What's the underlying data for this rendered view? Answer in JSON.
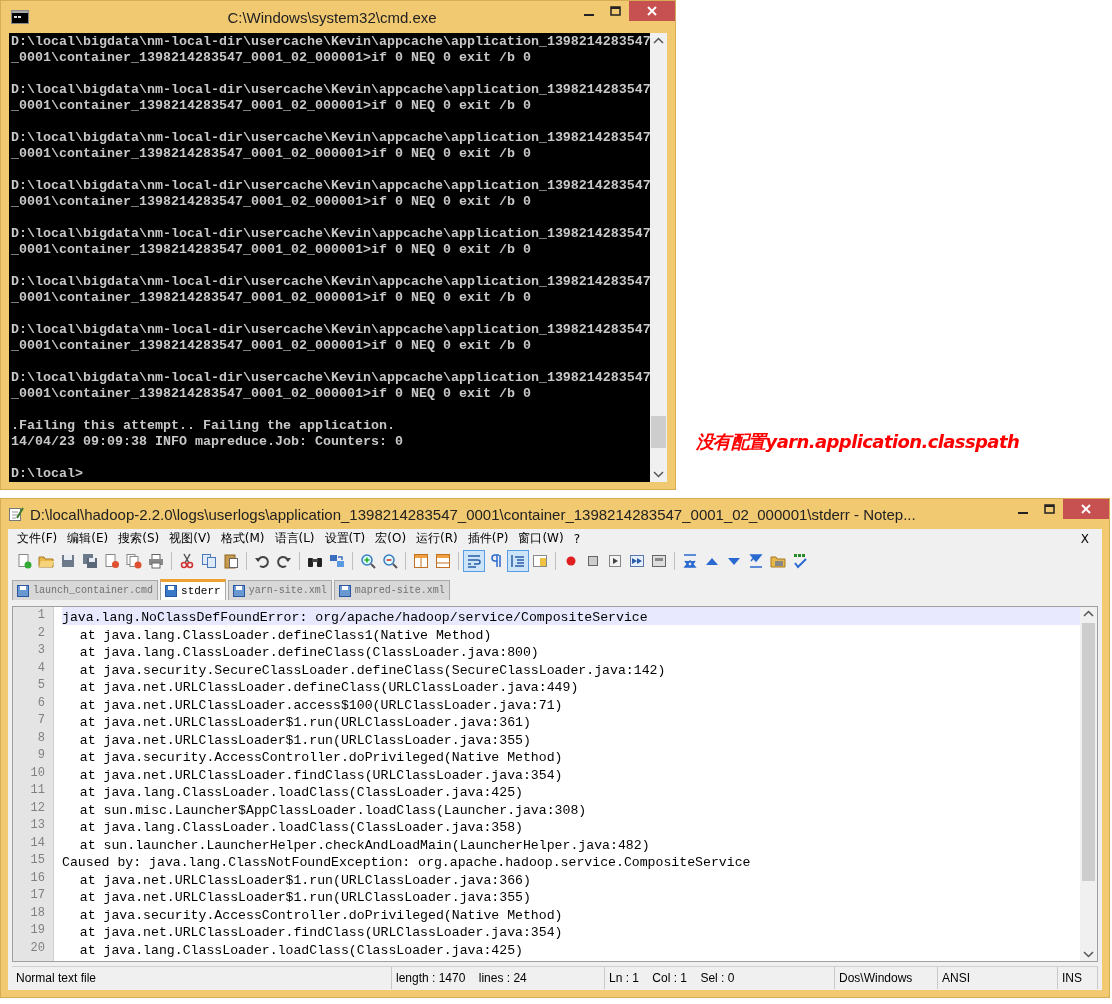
{
  "console_window": {
    "title": "C:\\Windows\\system32\\cmd.exe",
    "blocks": [
      [
        "D:\\local\\bigdata\\nm-local-dir\\usercache\\Kevin\\appcache\\application_1398214283547",
        "_0001\\container_1398214283547_0001_02_000001>if 0 NEQ 0 exit /b 0"
      ],
      [
        "D:\\local\\bigdata\\nm-local-dir\\usercache\\Kevin\\appcache\\application_1398214283547",
        "_0001\\container_1398214283547_0001_02_000001>if 0 NEQ 0 exit /b 0"
      ],
      [
        "D:\\local\\bigdata\\nm-local-dir\\usercache\\Kevin\\appcache\\application_1398214283547",
        "_0001\\container_1398214283547_0001_02_000001>if 0 NEQ 0 exit /b 0"
      ],
      [
        "D:\\local\\bigdata\\nm-local-dir\\usercache\\Kevin\\appcache\\application_1398214283547",
        "_0001\\container_1398214283547_0001_02_000001>if 0 NEQ 0 exit /b 0"
      ],
      [
        "D:\\local\\bigdata\\nm-local-dir\\usercache\\Kevin\\appcache\\application_1398214283547",
        "_0001\\container_1398214283547_0001_02_000001>if 0 NEQ 0 exit /b 0"
      ],
      [
        "D:\\local\\bigdata\\nm-local-dir\\usercache\\Kevin\\appcache\\application_1398214283547",
        "_0001\\container_1398214283547_0001_02_000001>if 0 NEQ 0 exit /b 0"
      ],
      [
        "D:\\local\\bigdata\\nm-local-dir\\usercache\\Kevin\\appcache\\application_1398214283547",
        "_0001\\container_1398214283547_0001_02_000001>if 0 NEQ 0 exit /b 0"
      ],
      [
        "D:\\local\\bigdata\\nm-local-dir\\usercache\\Kevin\\appcache\\application_1398214283547",
        "_0001\\container_1398214283547_0001_02_000001>if 0 NEQ 0 exit /b 0"
      ],
      [
        ".Failing this attempt.. Failing the application.",
        "14/04/23 09:09:38 INFO mapreduce.Job: Counters: 0"
      ],
      [
        "D:\\local>"
      ]
    ]
  },
  "annotation": "没有配置yarn.application.classpath",
  "editor_window": {
    "title": "D:\\local\\hadoop-2.2.0\\logs\\userlogs\\application_1398214283547_0001\\container_1398214283547_0001_02_000001\\stderr - Notep...",
    "menu": [
      "文件(F)",
      "编辑(E)",
      "搜索(S)",
      "视图(V)",
      "格式(M)",
      "语言(L)",
      "设置(T)",
      "宏(O)",
      "运行(R)",
      "插件(P)",
      "窗口(W)",
      "?"
    ],
    "menu_close": "X",
    "toolbar": [
      {
        "on": false
      },
      {
        "on": false
      },
      {
        "on": false
      },
      {
        "on": false
      },
      {
        "on": false
      },
      {
        "on": false
      },
      {
        "on": false
      },
      {
        "on": false
      },
      {
        "on": false
      },
      {
        "on": false
      },
      {
        "on": false
      },
      {
        "on": false
      },
      {
        "on": false
      },
      {
        "on": false
      },
      {
        "on": false
      },
      {
        "on": false
      },
      {
        "on": false
      },
      {
        "on": false
      },
      {
        "on": true
      },
      {
        "on": false
      },
      {
        "on": true
      },
      {
        "on": false
      },
      {
        "on": false
      },
      {
        "on": false
      },
      {
        "on": false
      },
      {
        "on": false
      },
      {
        "on": false
      },
      {
        "on": false
      },
      {
        "on": false
      },
      {
        "on": false
      },
      {
        "on": false
      },
      {
        "on": false
      },
      {
        "on": false
      }
    ],
    "tabs": [
      {
        "label": "launch_container.cmd",
        "selected": false
      },
      {
        "label": "stderr",
        "selected": true
      },
      {
        "label": "yarn-site.xml",
        "selected": false
      },
      {
        "label": "mapred-site.xml",
        "selected": false
      }
    ],
    "lines": [
      {
        "number": "1",
        "text": "java.lang.NoClassDefFoundError: org/apache/hadoop/service/CompositeService",
        "current": true
      },
      {
        "number": "2",
        "text": "\tat java.lang.ClassLoader.defineClass1(Native Method)",
        "current": false
      },
      {
        "number": "3",
        "text": "\tat java.lang.ClassLoader.defineClass(ClassLoader.java:800)",
        "current": false
      },
      {
        "number": "4",
        "text": "\tat java.security.SecureClassLoader.defineClass(SecureClassLoader.java:142)",
        "current": false
      },
      {
        "number": "5",
        "text": "\tat java.net.URLClassLoader.defineClass(URLClassLoader.java:449)",
        "current": false
      },
      {
        "number": "6",
        "text": "\tat java.net.URLClassLoader.access$100(URLClassLoader.java:71)",
        "current": false
      },
      {
        "number": "7",
        "text": "\tat java.net.URLClassLoader$1.run(URLClassLoader.java:361)",
        "current": false
      },
      {
        "number": "8",
        "text": "\tat java.net.URLClassLoader$1.run(URLClassLoader.java:355)",
        "current": false
      },
      {
        "number": "9",
        "text": "\tat java.security.AccessController.doPrivileged(Native Method)",
        "current": false
      },
      {
        "number": "10",
        "text": "\tat java.net.URLClassLoader.findClass(URLClassLoader.java:354)",
        "current": false
      },
      {
        "number": "11",
        "text": "\tat java.lang.ClassLoader.loadClass(ClassLoader.java:425)",
        "current": false
      },
      {
        "number": "12",
        "text": "\tat sun.misc.Launcher$AppClassLoader.loadClass(Launcher.java:308)",
        "current": false
      },
      {
        "number": "13",
        "text": "\tat java.lang.ClassLoader.loadClass(ClassLoader.java:358)",
        "current": false
      },
      {
        "number": "14",
        "text": "\tat sun.launcher.LauncherHelper.checkAndLoadMain(LauncherHelper.java:482)",
        "current": false
      },
      {
        "number": "15",
        "text": "Caused by: java.lang.ClassNotFoundException: org.apache.hadoop.service.CompositeService",
        "current": false
      },
      {
        "number": "16",
        "text": "\tat java.net.URLClassLoader$1.run(URLClassLoader.java:366)",
        "current": false
      },
      {
        "number": "17",
        "text": "\tat java.net.URLClassLoader$1.run(URLClassLoader.java:355)",
        "current": false
      },
      {
        "number": "18",
        "text": "\tat java.security.AccessController.doPrivileged(Native Method)",
        "current": false
      },
      {
        "number": "19",
        "text": "\tat java.net.URLClassLoader.findClass(URLClassLoader.java:354)",
        "current": false
      },
      {
        "number": "20",
        "text": "\tat java.lang.ClassLoader.loadClass(ClassLoader.java:425)",
        "current": false
      }
    ],
    "status_bar": [
      "Normal text file",
      "length : 1470    lines : 24",
      "Ln : 1    Col : 1    Sel : 0",
      "Dos\\Windows",
      "ANSI",
      "INS"
    ]
  }
}
